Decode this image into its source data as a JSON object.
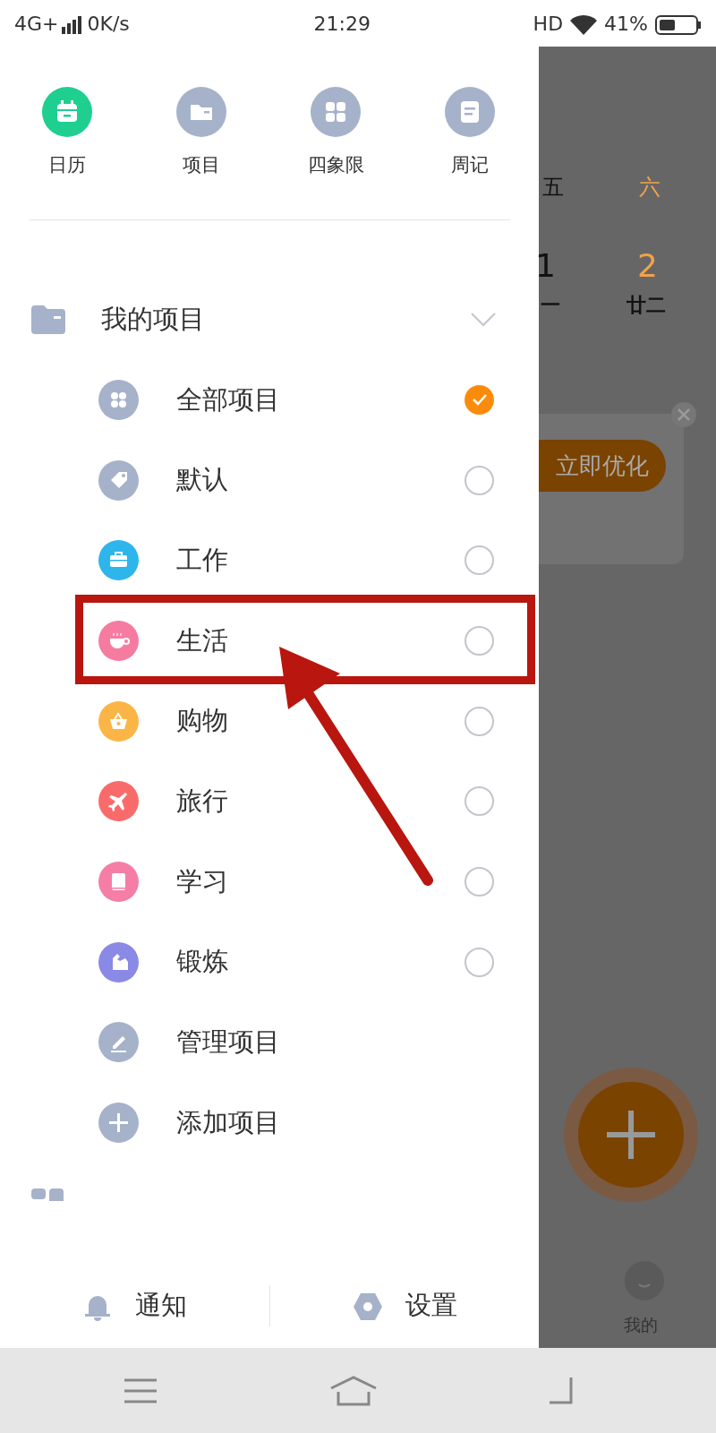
{
  "status_bar": {
    "network": "4G+",
    "speed": "0K/s",
    "time": "21:29",
    "hd": "HD",
    "battery": "41%"
  },
  "quick_links": [
    {
      "label": "日历",
      "kind": "calendar",
      "color": "#1fcf8f"
    },
    {
      "label": "项目",
      "kind": "folder",
      "color": "#a6b2ca"
    },
    {
      "label": "四象限",
      "kind": "grid",
      "color": "#a6b2ca"
    },
    {
      "label": "周记",
      "kind": "note",
      "color": "#a6b2ca"
    }
  ],
  "projects": {
    "title": "我的项目",
    "expanded": true,
    "items": [
      {
        "label": "全部项目",
        "kind": "all",
        "color": "#a6b2ca",
        "selected": true
      },
      {
        "label": "默认",
        "kind": "tag",
        "color": "#a6b2ca",
        "selected": false
      },
      {
        "label": "工作",
        "kind": "briefcase",
        "color": "#2eb5ec",
        "selected": false
      },
      {
        "label": "生活",
        "kind": "cup",
        "color": "#f67ba0",
        "selected": false
      },
      {
        "label": "购物",
        "kind": "basket",
        "color": "#fbb546",
        "selected": false
      },
      {
        "label": "旅行",
        "kind": "plane",
        "color": "#f96b6b",
        "selected": false
      },
      {
        "label": "学习",
        "kind": "book",
        "color": "#f47ea6",
        "selected": false
      },
      {
        "label": "锻炼",
        "kind": "arm",
        "color": "#8b89e6",
        "selected": false
      }
    ]
  },
  "actions": [
    {
      "label": "管理项目",
      "kind": "edit"
    },
    {
      "label": "添加项目",
      "kind": "add"
    }
  ],
  "footer": [
    {
      "label": "通知",
      "kind": "bell"
    },
    {
      "label": "设置",
      "kind": "gear"
    }
  ],
  "background": {
    "weekdays": [
      {
        "label": "五",
        "weekend": false
      },
      {
        "label": "六",
        "weekend": true
      }
    ],
    "dates": [
      {
        "day": "1",
        "lunar": "一",
        "weekend": false
      },
      {
        "day": "2",
        "lunar": "廿二",
        "weekend": true
      }
    ],
    "promo_button": "立即优化",
    "tab": "我的"
  }
}
